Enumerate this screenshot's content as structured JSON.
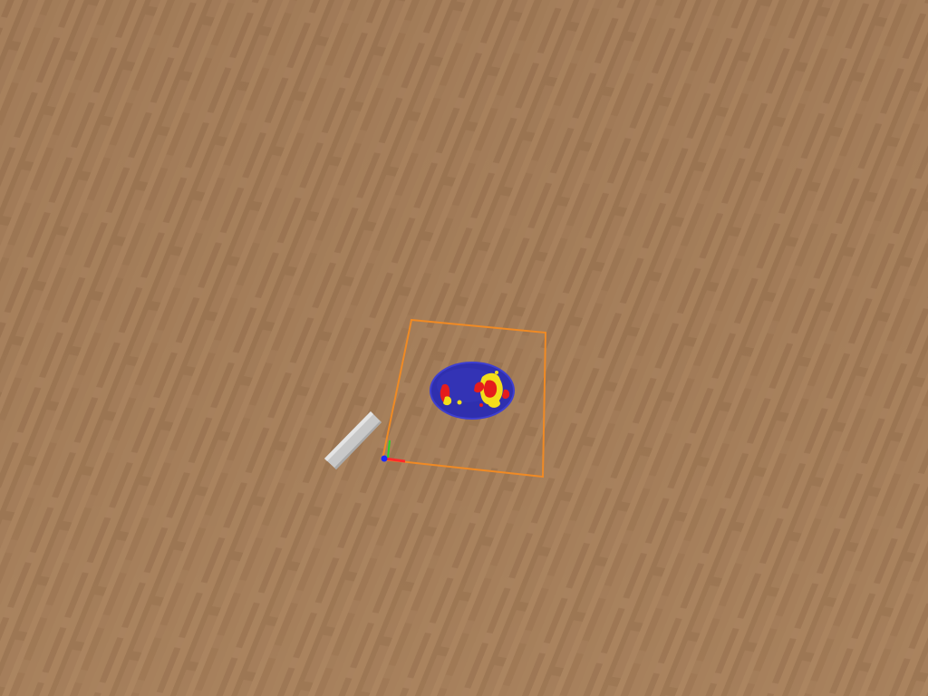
{
  "scene": {
    "type": "3d-simulation-viewport",
    "floor_material": "wood-plank-floor",
    "objects": [
      {
        "name": "workspace-boundary",
        "kind": "selection-frame",
        "color": "#f08a24"
      },
      {
        "name": "plate-object",
        "kind": "disc",
        "colors": [
          "#2f2fae",
          "#e51c1c",
          "#f2de1a"
        ]
      },
      {
        "name": "cylinder-tool",
        "kind": "rod",
        "color": "#c8c8c8"
      },
      {
        "name": "origin-axes-gizmo",
        "kind": "axes",
        "colors": [
          "#ff2a2a",
          "#2ad12a",
          "#1a2aff"
        ]
      }
    ]
  },
  "colors": {
    "floor_light": "#b08a64",
    "floor_mid": "#9e7753",
    "floor_dark": "#8c6645",
    "selection": "#f08a24",
    "disc_blue": "#2f2fae",
    "splat_red": "#e51c1c",
    "splat_yellow": "#f2de1a"
  }
}
